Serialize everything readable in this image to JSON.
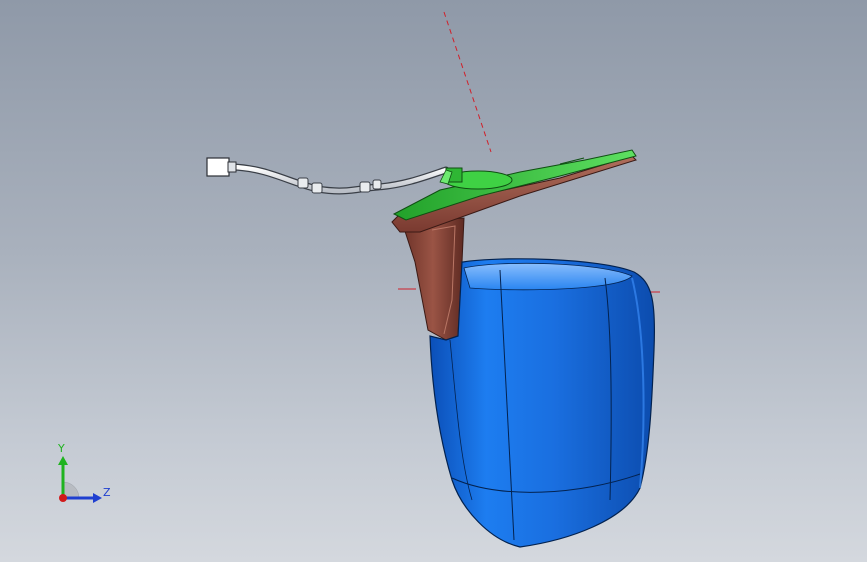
{
  "viewport": {
    "background_top": "#8f99a8",
    "background_bottom": "#d4d8de"
  },
  "model": {
    "housing_color": "#1a74e8",
    "arm_color": "#8e4a3d",
    "board_color": "#35c23a",
    "cable_color": "#f2f2f2",
    "centerline_color": "#d0202a"
  },
  "triad": {
    "y_label": "Y",
    "z_label": "Z",
    "y_color": "#1fb31f",
    "z_color": "#1f3fd0",
    "x_color": "#d01a1a"
  }
}
